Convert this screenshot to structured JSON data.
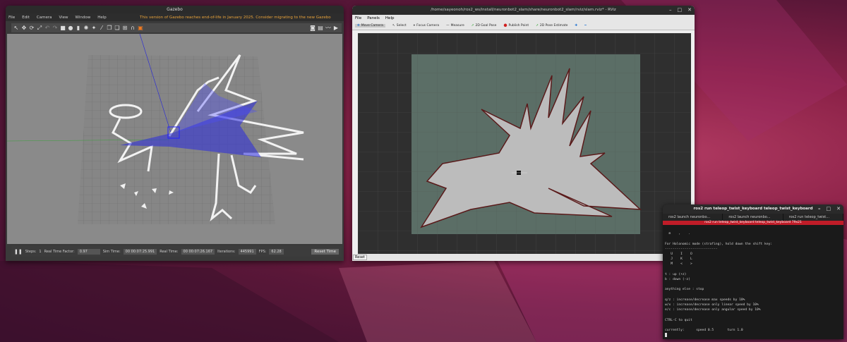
{
  "gazebo": {
    "title": "Gazebo",
    "menu": [
      "File",
      "Edit",
      "Camera",
      "View",
      "Window",
      "Help"
    ],
    "warning": "This version of Gazebo reaches end-of-life in January 2025. Consider migrating to the new Gazebo",
    "status": {
      "steps_label": "Steps:",
      "steps_value": "1",
      "rtf_label": "Real Time Factor:",
      "rtf_value": "0.97",
      "sim_label": "Sim Time:",
      "sim_value": "00 00:07:25.991",
      "real_label": "Real Time:",
      "real_value": "00 00:07:26.167",
      "iter_label": "Iterations:",
      "iter_value": "445991",
      "fps_label": "FPS:",
      "fps_value": "62.28",
      "reset_label": "Reset Time"
    }
  },
  "rviz": {
    "title": "/home/sayeonoh/ros2_ws/install/neuronbot2_slam/share/neuronbot2_slam/rviz/slam.rviz* - RViz",
    "menu": [
      "File",
      "Panels",
      "Help"
    ],
    "tools": [
      "Move Camera",
      "Select",
      "Focus Camera",
      "Measure",
      "2D Goal Pose",
      "Publish Point",
      "2D Pose Estimate"
    ],
    "reset_label": "Reset"
  },
  "terminal": {
    "title": "ros2 run teleop_twist_keyboard teleop_twist_keyboard",
    "tabs": [
      "ros2 launch neuronbo...",
      "ros2 launch neuronbo...",
      "ros2 run teleop_twist..."
    ],
    "active_bar": "ros2 run teleop_twist_keyboard teleop_twist_keyboard 79x21",
    "lines": [
      "  m    ,    .",
      "",
      "For Holonomic mode (strafing), hold down the shift key:",
      "---------------------------",
      "   U    I    O",
      "   J    K    L",
      "   M    <    >",
      "",
      "t : up (+z)",
      "b : down (-z)",
      "",
      "anything else : stop",
      "",
      "q/z : increase/decrease max speeds by 10%",
      "w/x : increase/decrease only linear speed by 10%",
      "e/c : increase/decrease only angular speed by 10%",
      "",
      "CTRL-C to quit",
      "",
      "currently:      speed 0.5       turn 1.0"
    ]
  }
}
